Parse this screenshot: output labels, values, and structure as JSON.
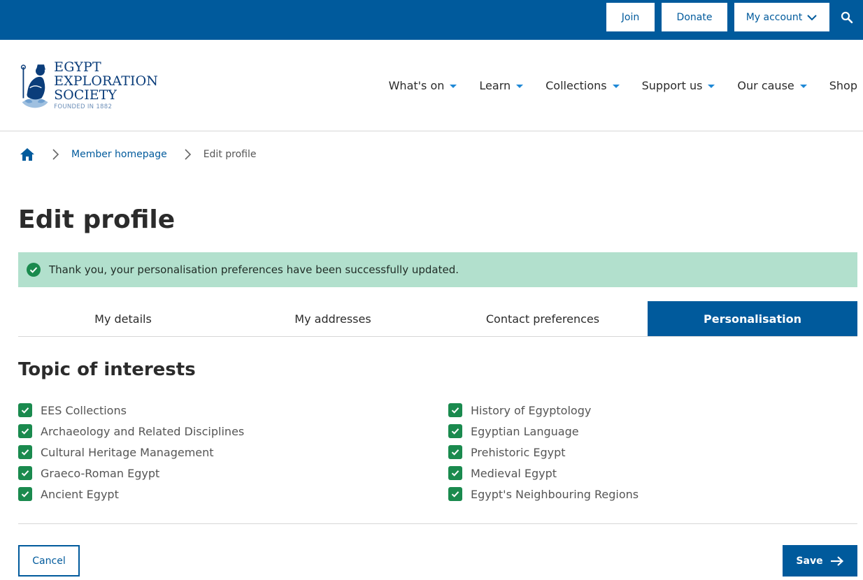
{
  "topbar": {
    "join_label": "Join",
    "donate_label": "Donate",
    "account_label": "My account",
    "bg_color": "#005a9c"
  },
  "logo": {
    "line1": "EGYPT",
    "line2": "EXPLORATION",
    "line3": "SOCIETY",
    "line4": "FOUNDED IN 1882"
  },
  "nav": {
    "items": [
      {
        "label": "What's on",
        "has_dropdown": true
      },
      {
        "label": "Learn",
        "has_dropdown": true
      },
      {
        "label": "Collections",
        "has_dropdown": true
      },
      {
        "label": "Support us",
        "has_dropdown": true
      },
      {
        "label": "Our cause",
        "has_dropdown": true
      },
      {
        "label": "Shop",
        "has_dropdown": false
      }
    ]
  },
  "breadcrumb": {
    "home_icon": "home-icon",
    "link": "Member homepage",
    "current": "Edit profile"
  },
  "page": {
    "title": "Edit profile"
  },
  "alert": {
    "message": "Thank you, your personalisation preferences have been successfully updated.",
    "color": "#b2e0cd"
  },
  "tabs": [
    {
      "label": "My details",
      "active": false
    },
    {
      "label": "My addresses",
      "active": false
    },
    {
      "label": "Contact preferences",
      "active": false
    },
    {
      "label": "Personalisation",
      "active": true
    }
  ],
  "interests": {
    "title": "Topic of interests",
    "left": [
      {
        "label": "EES Collections",
        "checked": true
      },
      {
        "label": "Archaeology and Related Disciplines",
        "checked": true
      },
      {
        "label": "Cultural Heritage Management",
        "checked": true
      },
      {
        "label": "Graeco-Roman Egypt",
        "checked": true
      },
      {
        "label": "Ancient Egypt",
        "checked": true
      }
    ],
    "right": [
      {
        "label": "History of Egyptology",
        "checked": true
      },
      {
        "label": "Egyptian Language",
        "checked": true
      },
      {
        "label": "Prehistoric Egypt",
        "checked": true
      },
      {
        "label": "Medieval Egypt",
        "checked": true
      },
      {
        "label": "Egypt's Neighbouring Regions",
        "checked": true
      }
    ]
  },
  "actions": {
    "cancel_label": "Cancel",
    "save_label": "Save"
  }
}
